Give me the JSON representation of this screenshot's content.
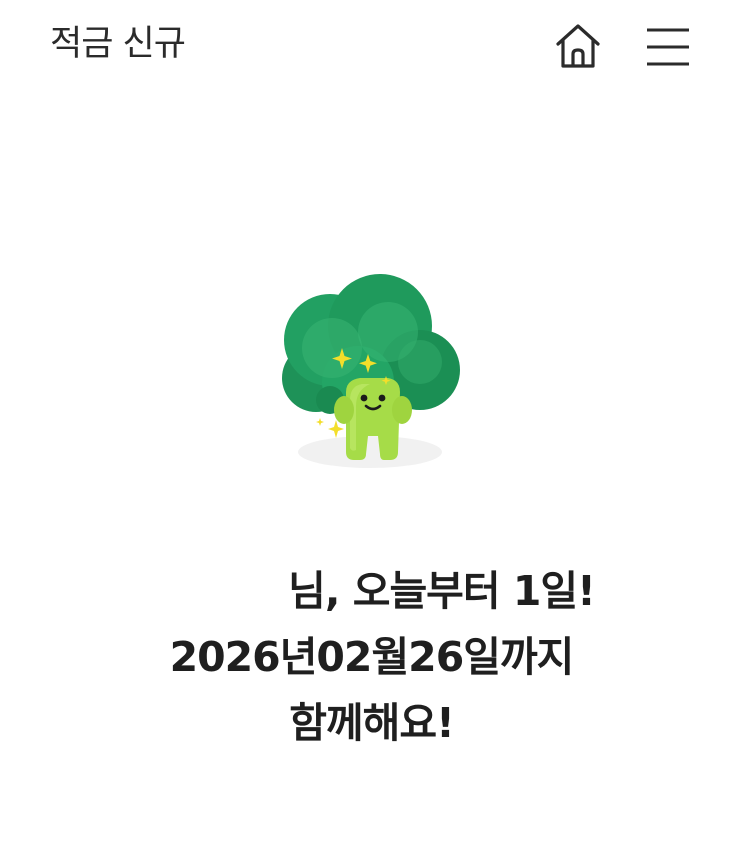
{
  "header": {
    "title": "적금 신규",
    "home_icon": "home-icon",
    "menu_icon": "hamburger-menu-icon"
  },
  "mascot": {
    "icon": "broccoli-character-illustration"
  },
  "message": {
    "line1": "님, 오늘부터 1일!",
    "line2": "2026년02월26일까지",
    "line3": "함께해요!"
  },
  "colors": {
    "text": "#1f1f1f",
    "broccoli_dark": "#1f9a5c",
    "broccoli_light": "#3cb873",
    "stem": "#a3d94a",
    "sparkle": "#f3de2a"
  }
}
